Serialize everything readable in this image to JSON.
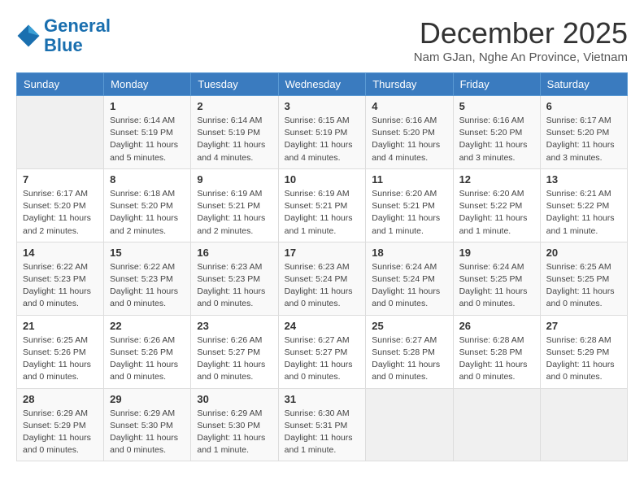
{
  "logo": {
    "line1": "General",
    "line2": "Blue"
  },
  "title": "December 2025",
  "location": "Nam GJan, Nghe An Province, Vietnam",
  "weekdays": [
    "Sunday",
    "Monday",
    "Tuesday",
    "Wednesday",
    "Thursday",
    "Friday",
    "Saturday"
  ],
  "weeks": [
    [
      {
        "day": "",
        "info": ""
      },
      {
        "day": "1",
        "info": "Sunrise: 6:14 AM\nSunset: 5:19 PM\nDaylight: 11 hours\nand 5 minutes."
      },
      {
        "day": "2",
        "info": "Sunrise: 6:14 AM\nSunset: 5:19 PM\nDaylight: 11 hours\nand 4 minutes."
      },
      {
        "day": "3",
        "info": "Sunrise: 6:15 AM\nSunset: 5:19 PM\nDaylight: 11 hours\nand 4 minutes."
      },
      {
        "day": "4",
        "info": "Sunrise: 6:16 AM\nSunset: 5:20 PM\nDaylight: 11 hours\nand 4 minutes."
      },
      {
        "day": "5",
        "info": "Sunrise: 6:16 AM\nSunset: 5:20 PM\nDaylight: 11 hours\nand 3 minutes."
      },
      {
        "day": "6",
        "info": "Sunrise: 6:17 AM\nSunset: 5:20 PM\nDaylight: 11 hours\nand 3 minutes."
      }
    ],
    [
      {
        "day": "7",
        "info": "Sunrise: 6:17 AM\nSunset: 5:20 PM\nDaylight: 11 hours\nand 2 minutes."
      },
      {
        "day": "8",
        "info": "Sunrise: 6:18 AM\nSunset: 5:20 PM\nDaylight: 11 hours\nand 2 minutes."
      },
      {
        "day": "9",
        "info": "Sunrise: 6:19 AM\nSunset: 5:21 PM\nDaylight: 11 hours\nand 2 minutes."
      },
      {
        "day": "10",
        "info": "Sunrise: 6:19 AM\nSunset: 5:21 PM\nDaylight: 11 hours\nand 1 minute."
      },
      {
        "day": "11",
        "info": "Sunrise: 6:20 AM\nSunset: 5:21 PM\nDaylight: 11 hours\nand 1 minute."
      },
      {
        "day": "12",
        "info": "Sunrise: 6:20 AM\nSunset: 5:22 PM\nDaylight: 11 hours\nand 1 minute."
      },
      {
        "day": "13",
        "info": "Sunrise: 6:21 AM\nSunset: 5:22 PM\nDaylight: 11 hours\nand 1 minute."
      }
    ],
    [
      {
        "day": "14",
        "info": "Sunrise: 6:22 AM\nSunset: 5:23 PM\nDaylight: 11 hours\nand 0 minutes."
      },
      {
        "day": "15",
        "info": "Sunrise: 6:22 AM\nSunset: 5:23 PM\nDaylight: 11 hours\nand 0 minutes."
      },
      {
        "day": "16",
        "info": "Sunrise: 6:23 AM\nSunset: 5:23 PM\nDaylight: 11 hours\nand 0 minutes."
      },
      {
        "day": "17",
        "info": "Sunrise: 6:23 AM\nSunset: 5:24 PM\nDaylight: 11 hours\nand 0 minutes."
      },
      {
        "day": "18",
        "info": "Sunrise: 6:24 AM\nSunset: 5:24 PM\nDaylight: 11 hours\nand 0 minutes."
      },
      {
        "day": "19",
        "info": "Sunrise: 6:24 AM\nSunset: 5:25 PM\nDaylight: 11 hours\nand 0 minutes."
      },
      {
        "day": "20",
        "info": "Sunrise: 6:25 AM\nSunset: 5:25 PM\nDaylight: 11 hours\nand 0 minutes."
      }
    ],
    [
      {
        "day": "21",
        "info": "Sunrise: 6:25 AM\nSunset: 5:26 PM\nDaylight: 11 hours\nand 0 minutes."
      },
      {
        "day": "22",
        "info": "Sunrise: 6:26 AM\nSunset: 5:26 PM\nDaylight: 11 hours\nand 0 minutes."
      },
      {
        "day": "23",
        "info": "Sunrise: 6:26 AM\nSunset: 5:27 PM\nDaylight: 11 hours\nand 0 minutes."
      },
      {
        "day": "24",
        "info": "Sunrise: 6:27 AM\nSunset: 5:27 PM\nDaylight: 11 hours\nand 0 minutes."
      },
      {
        "day": "25",
        "info": "Sunrise: 6:27 AM\nSunset: 5:28 PM\nDaylight: 11 hours\nand 0 minutes."
      },
      {
        "day": "26",
        "info": "Sunrise: 6:28 AM\nSunset: 5:28 PM\nDaylight: 11 hours\nand 0 minutes."
      },
      {
        "day": "27",
        "info": "Sunrise: 6:28 AM\nSunset: 5:29 PM\nDaylight: 11 hours\nand 0 minutes."
      }
    ],
    [
      {
        "day": "28",
        "info": "Sunrise: 6:29 AM\nSunset: 5:29 PM\nDaylight: 11 hours\nand 0 minutes."
      },
      {
        "day": "29",
        "info": "Sunrise: 6:29 AM\nSunset: 5:30 PM\nDaylight: 11 hours\nand 0 minutes."
      },
      {
        "day": "30",
        "info": "Sunrise: 6:29 AM\nSunset: 5:30 PM\nDaylight: 11 hours\nand 1 minute."
      },
      {
        "day": "31",
        "info": "Sunrise: 6:30 AM\nSunset: 5:31 PM\nDaylight: 11 hours\nand 1 minute."
      },
      {
        "day": "",
        "info": ""
      },
      {
        "day": "",
        "info": ""
      },
      {
        "day": "",
        "info": ""
      }
    ]
  ]
}
